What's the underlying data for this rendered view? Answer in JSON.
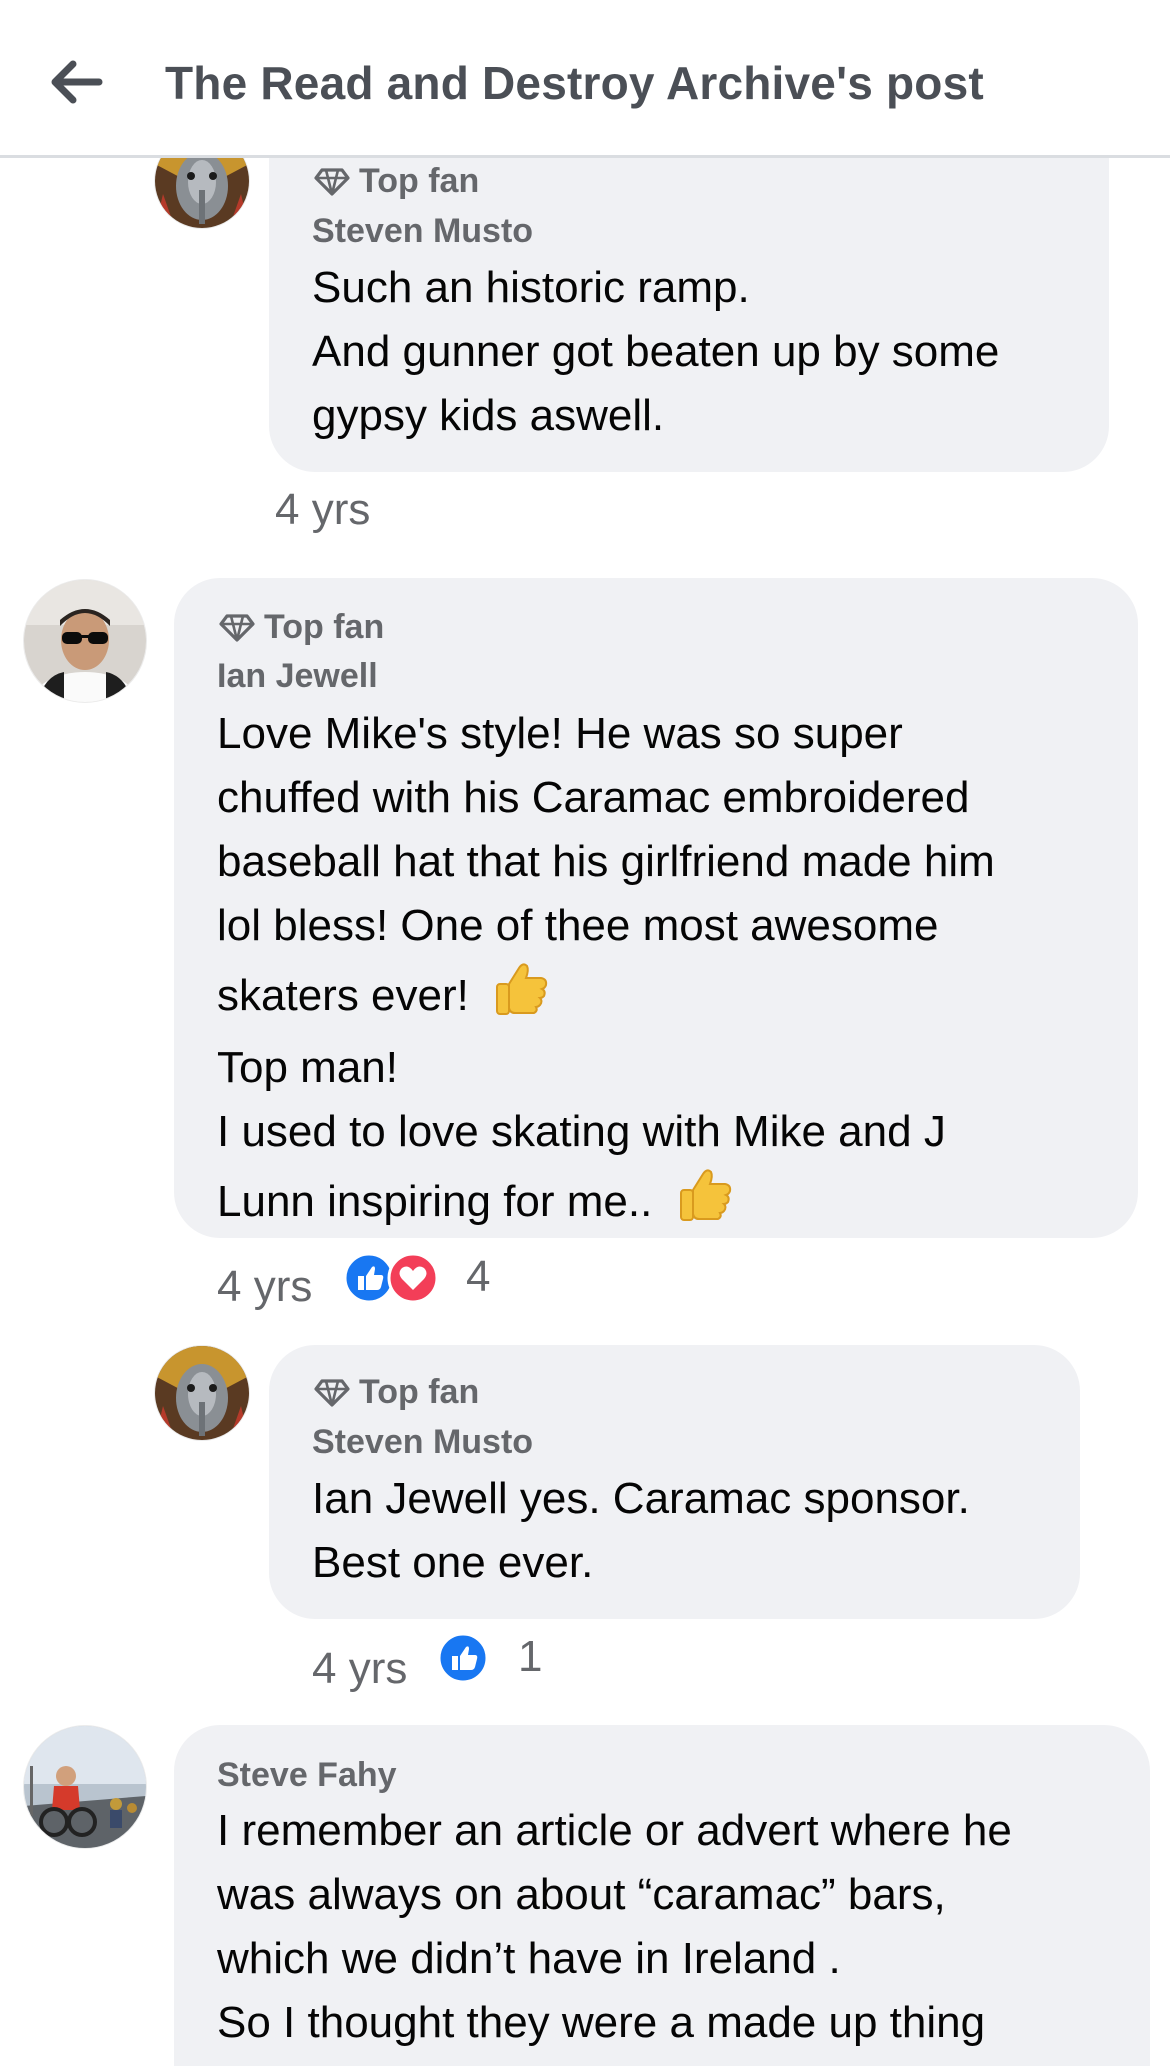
{
  "header": {
    "title": "The Read and Destroy Archive's post",
    "back_icon": "arrow-left-icon"
  },
  "colors": {
    "bubble": "#f0f1f4",
    "meta_text": "#65676b",
    "like_blue": "#1877f2",
    "love_red": "#f33e58",
    "header_border": "#dadde1"
  },
  "comments": [
    {
      "badge": "Top fan",
      "author": "Steven Musto",
      "lines": [
        "Such an historic ramp.",
        "And gunner got beaten up by some",
        "gypsy kids aswell."
      ],
      "time": "4 yrs"
    },
    {
      "badge": "Top fan",
      "author": "Ian Jewell",
      "lines": [
        "Love Mike's style! He was so super",
        "chuffed with his Caramac embroidered",
        "baseball hat that his girlfriend made him",
        "lol bless! One of thee most awesome",
        "skaters ever!",
        "Top man!",
        "I used to love skating with Mike and J",
        "Lunn inspiring for me.."
      ],
      "time": "4 yrs",
      "reactions": [
        "like",
        "love"
      ],
      "reaction_count": "4"
    },
    {
      "badge": "Top fan",
      "author": "Steven Musto",
      "lines": [
        "Ian Jewell yes. Caramac sponsor.",
        "Best one ever."
      ],
      "time": "4 yrs",
      "reactions": [
        "like"
      ],
      "reaction_count": "1"
    },
    {
      "author": "Steve Fahy",
      "lines": [
        "I remember an article or advert where he",
        "was always on about “caramac” bars,",
        "which we didn’t have in Ireland .",
        "So I thought they were a made up thing"
      ]
    }
  ]
}
